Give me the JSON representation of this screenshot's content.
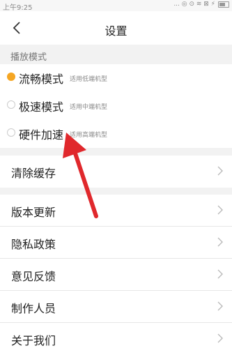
{
  "status_bar": {
    "time": "上午9:25",
    "icons_text": "... ◎ ⊙ ≋ ⊠ ⚡"
  },
  "header": {
    "title": "设置"
  },
  "play_mode": {
    "section_label": "播放模式",
    "options": [
      {
        "name": "流畅模式",
        "hint": "适用低端机型",
        "selected": true
      },
      {
        "name": "极速模式",
        "hint": "适用中端机型",
        "selected": false
      },
      {
        "name": "硬件加速",
        "hint": "适用高端机型",
        "selected": false
      }
    ]
  },
  "menu": {
    "clear_cache": "清除缓存",
    "items": [
      "版本更新",
      "隐私政策",
      "意见反馈",
      "制作人员",
      "关于我们"
    ]
  },
  "colors": {
    "accent": "#f5a623",
    "annotation_arrow": "#e0282c"
  }
}
